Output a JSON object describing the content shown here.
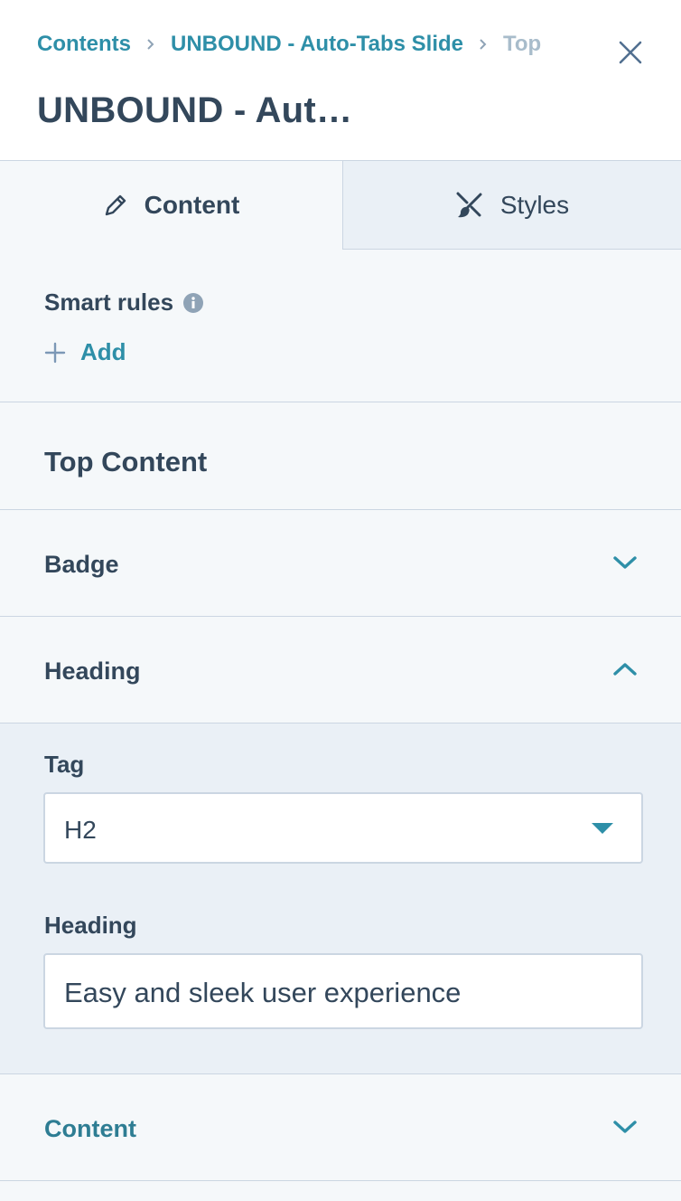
{
  "breadcrumb": {
    "items": [
      "Contents",
      "UNBOUND - Auto-Tabs Slide",
      "Top"
    ]
  },
  "header": {
    "title": "UNBOUND - Aut…"
  },
  "tabs": [
    {
      "label": "Content",
      "icon": "pencil-icon",
      "active": true
    },
    {
      "label": "Styles",
      "icon": "brush-icon",
      "active": false
    }
  ],
  "smart_rules": {
    "label": "Smart rules",
    "add_label": "Add"
  },
  "section": {
    "title": "Top Content"
  },
  "accordions": {
    "badge": {
      "label": "Badge",
      "expanded": false
    },
    "heading": {
      "label": "Heading",
      "expanded": true
    },
    "content": {
      "label": "Content",
      "expanded": false
    }
  },
  "heading_fields": {
    "tag_label": "Tag",
    "tag_value": "H2",
    "heading_label": "Heading",
    "heading_value": "Easy and sleek user experience"
  },
  "colors": {
    "link": "#2e8fa8",
    "text": "#33475b",
    "border": "#cbd6e2",
    "panel": "#f5f8fa",
    "panel_alt": "#eaf0f6"
  }
}
